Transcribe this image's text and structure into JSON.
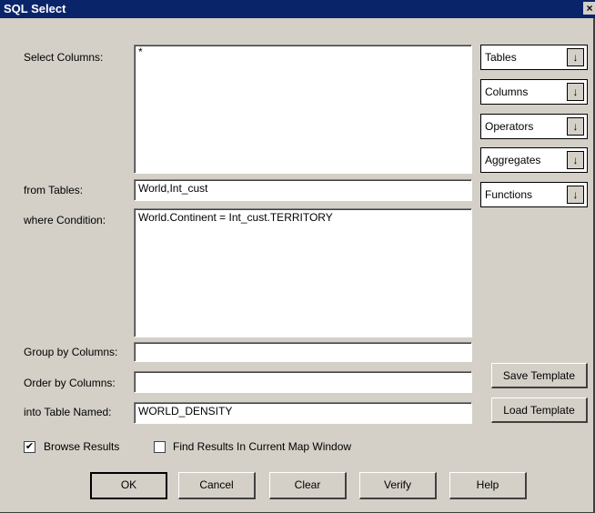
{
  "window": {
    "title": "SQL Select",
    "close": "×"
  },
  "labels": {
    "select_columns": "Select Columns:",
    "from_tables": "from Tables:",
    "where_condition": "where Condition:",
    "group_by": "Group by Columns:",
    "order_by": "Order by Columns:",
    "into_table": "into Table Named:"
  },
  "fields": {
    "select_columns": "*",
    "from_tables": "World,Int_cust",
    "where_condition": "World.Continent = Int_cust.TERRITORY",
    "group_by": "",
    "order_by": "",
    "into_table": "WORLD_DENSITY"
  },
  "dropdowns": [
    "Tables",
    "Columns",
    "Operators",
    "Aggregates",
    "Functions"
  ],
  "dropdown_arrow": "↓",
  "buttons": {
    "save_template": "Save Template",
    "load_template": "Load Template",
    "ok": "OK",
    "cancel": "Cancel",
    "clear": "Clear",
    "verify": "Verify",
    "help": "Help"
  },
  "checkboxes": {
    "browse_results": {
      "label": "Browse Results",
      "checked": true,
      "mark": "✔"
    },
    "find_results": {
      "label": "Find Results In Current Map Window",
      "checked": false,
      "mark": ""
    }
  }
}
